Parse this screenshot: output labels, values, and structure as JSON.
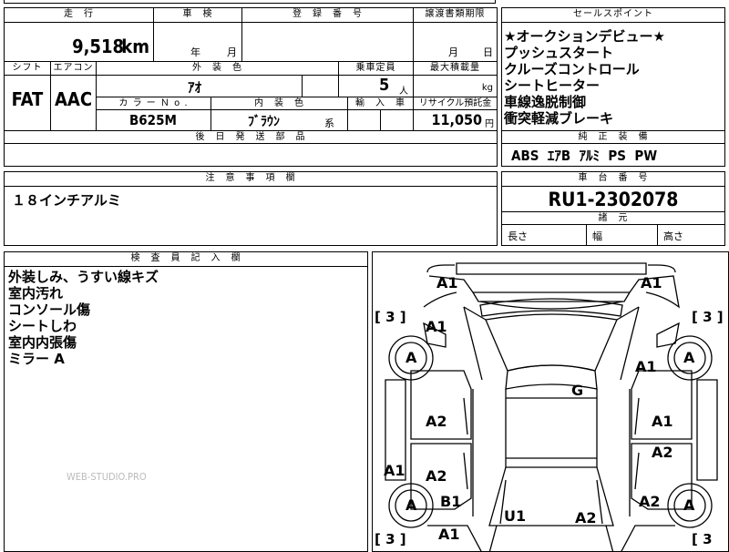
{
  "mileage": {
    "label": "走　行",
    "value": "9,518",
    "unit": "km"
  },
  "inspection": {
    "label": "車　検",
    "year_unit": "年",
    "month_unit": "月"
  },
  "registration": {
    "label": "登　録　番　号"
  },
  "transfer_deadline": {
    "label": "譲渡書類期限",
    "month_unit": "月",
    "day_unit": "日"
  },
  "sales_points": {
    "label": "セールスポイント",
    "items": [
      "★オークションデビュー★",
      "プッシュスタート",
      "クルーズコントロール",
      "シートヒーター",
      "車線逸脱制御",
      "衝突軽減ブレーキ"
    ]
  },
  "shift": {
    "label": "シフト",
    "value": "FAT"
  },
  "aircon": {
    "label": "エアコン",
    "value": "AAC"
  },
  "exterior_color": {
    "label": "外　装　色",
    "value": "ｱｵ"
  },
  "capacity": {
    "label": "乗車定員",
    "value": "5",
    "unit": "人"
  },
  "max_load": {
    "label": "最大積載量",
    "unit": "kg"
  },
  "color_no": {
    "label": "カ ラ ー Ｎ o .",
    "value": "B625M"
  },
  "interior_color": {
    "label": "内　装　色",
    "value": "ﾌﾞﾗｳﾝ",
    "suffix": "系"
  },
  "import": {
    "label": "輸　入　車"
  },
  "recycle": {
    "label": "リサイクル預託金",
    "value": "11,050",
    "unit": "円"
  },
  "shipping_parts": {
    "label": "後　日　発　送　部　品"
  },
  "standard_equipment": {
    "label": "純　正　装　備",
    "value": "ABS  ｴｱB  ｱﾙﾐ  PS  PW"
  },
  "notes": {
    "label": "注　意　事　項　欄",
    "value": "１８インチアルミ"
  },
  "chassis": {
    "label": "車　台　番　号",
    "value": "RU1-2302078"
  },
  "dimensions": {
    "label": "諸　元",
    "length": "長さ",
    "width": "幅",
    "height": "高さ"
  },
  "inspector": {
    "label": "検　査　員　記　入　欄",
    "items": [
      "外装しみ、うすい線キズ",
      "室内汚れ",
      "コンソール傷",
      "シートしわ",
      "室内内張傷",
      "ミラー A"
    ]
  },
  "watermark": "WEB-STUDIO.PRO",
  "diagram_labels": {
    "a1_tl": "A1",
    "a1_tr": "A1",
    "b3_l": "[ 3 ]",
    "b3_r": "[ 3 ]",
    "a1_l2": "A1",
    "a_tl": "A",
    "a_tr": "A",
    "a1_r2": "A1",
    "g": "G",
    "a2_l": "A2",
    "a1_r3": "A1",
    "a2_r": "A2",
    "a1_l3": "A1",
    "a2_l2": "A2",
    "a_bl": "A",
    "b1": "B1",
    "a2_r2": "A2",
    "a_br": "A",
    "u1": "U1",
    "a2_bc": "A2",
    "a1_bl": "A1",
    "b3_bl": "[ 3 ]",
    "b3_br": "[ 3"
  }
}
